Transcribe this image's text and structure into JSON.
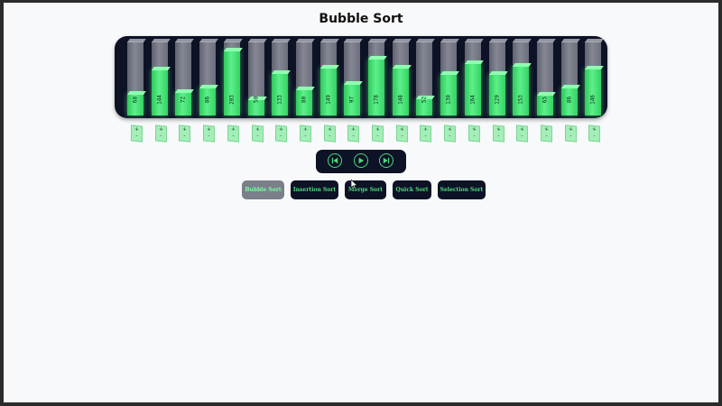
{
  "page": {
    "title": "Bubble Sort"
  },
  "bars": [
    {
      "value": 68,
      "label": "68"
    },
    {
      "value": 144,
      "label": "144"
    },
    {
      "value": 72,
      "label": "72"
    },
    {
      "value": 86,
      "label": "86"
    },
    {
      "value": 203,
      "label": "203"
    },
    {
      "value": 50,
      "label": "50"
    },
    {
      "value": 133,
      "label": "133"
    },
    {
      "value": 80,
      "label": "80"
    },
    {
      "value": 149,
      "label": "149"
    },
    {
      "value": 97,
      "label": "97"
    },
    {
      "value": 178,
      "label": "178"
    },
    {
      "value": 148,
      "label": "148"
    },
    {
      "value": 52,
      "label": "52"
    },
    {
      "value": 130,
      "label": "130"
    },
    {
      "value": 164,
      "label": "164"
    },
    {
      "value": 129,
      "label": "129"
    },
    {
      "value": 153,
      "label": "153"
    },
    {
      "value": 65,
      "label": "65"
    },
    {
      "value": 86,
      "label": "86"
    },
    {
      "value": 146,
      "label": "146"
    }
  ],
  "bar_scale_max": 230,
  "step_cards": {
    "top": "+",
    "bottom": "-"
  },
  "controls": {
    "prev_icon": "skip-back-icon",
    "play_icon": "play-icon",
    "next_icon": "skip-forward-icon",
    "accent_color": "#4dd97b"
  },
  "algorithms": [
    {
      "label": "Bubble Sort",
      "active": true
    },
    {
      "label": "Insertion Sort",
      "active": false
    },
    {
      "label": "Merge Sort",
      "active": false
    },
    {
      "label": "Quick Sort",
      "active": false
    },
    {
      "label": "Selection Sort",
      "active": false
    }
  ],
  "colors": {
    "panel": "#0d1226",
    "bar_fill": "#4dea7c",
    "active_button": "#7a7f8a"
  }
}
